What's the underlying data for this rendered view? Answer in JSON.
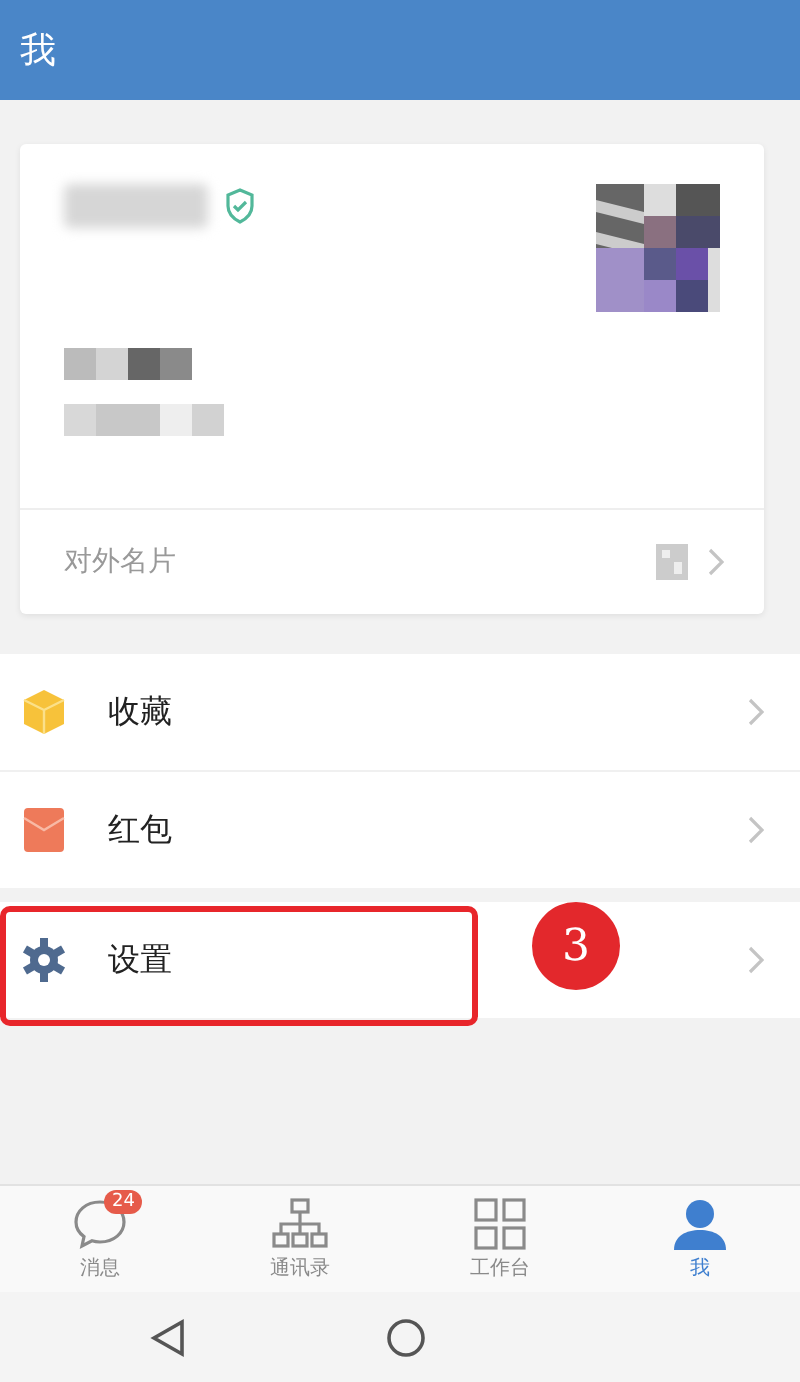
{
  "header": {
    "title": "我"
  },
  "profile_card": {
    "verified": true,
    "link_label": "对外名片"
  },
  "menu_groups": [
    [
      {
        "kind": "box",
        "label": "收藏"
      },
      {
        "kind": "envelope",
        "label": "红包"
      }
    ],
    [
      {
        "kind": "gear",
        "label": "设置"
      }
    ]
  ],
  "annotation": {
    "number": "3"
  },
  "tabs": [
    {
      "kind": "chat",
      "label": "消息",
      "badge": "24",
      "selected": false
    },
    {
      "kind": "tree",
      "label": "通讯录",
      "selected": false
    },
    {
      "kind": "grid",
      "label": "工作台",
      "selected": false
    },
    {
      "kind": "person",
      "label": "我",
      "selected": true
    }
  ]
}
